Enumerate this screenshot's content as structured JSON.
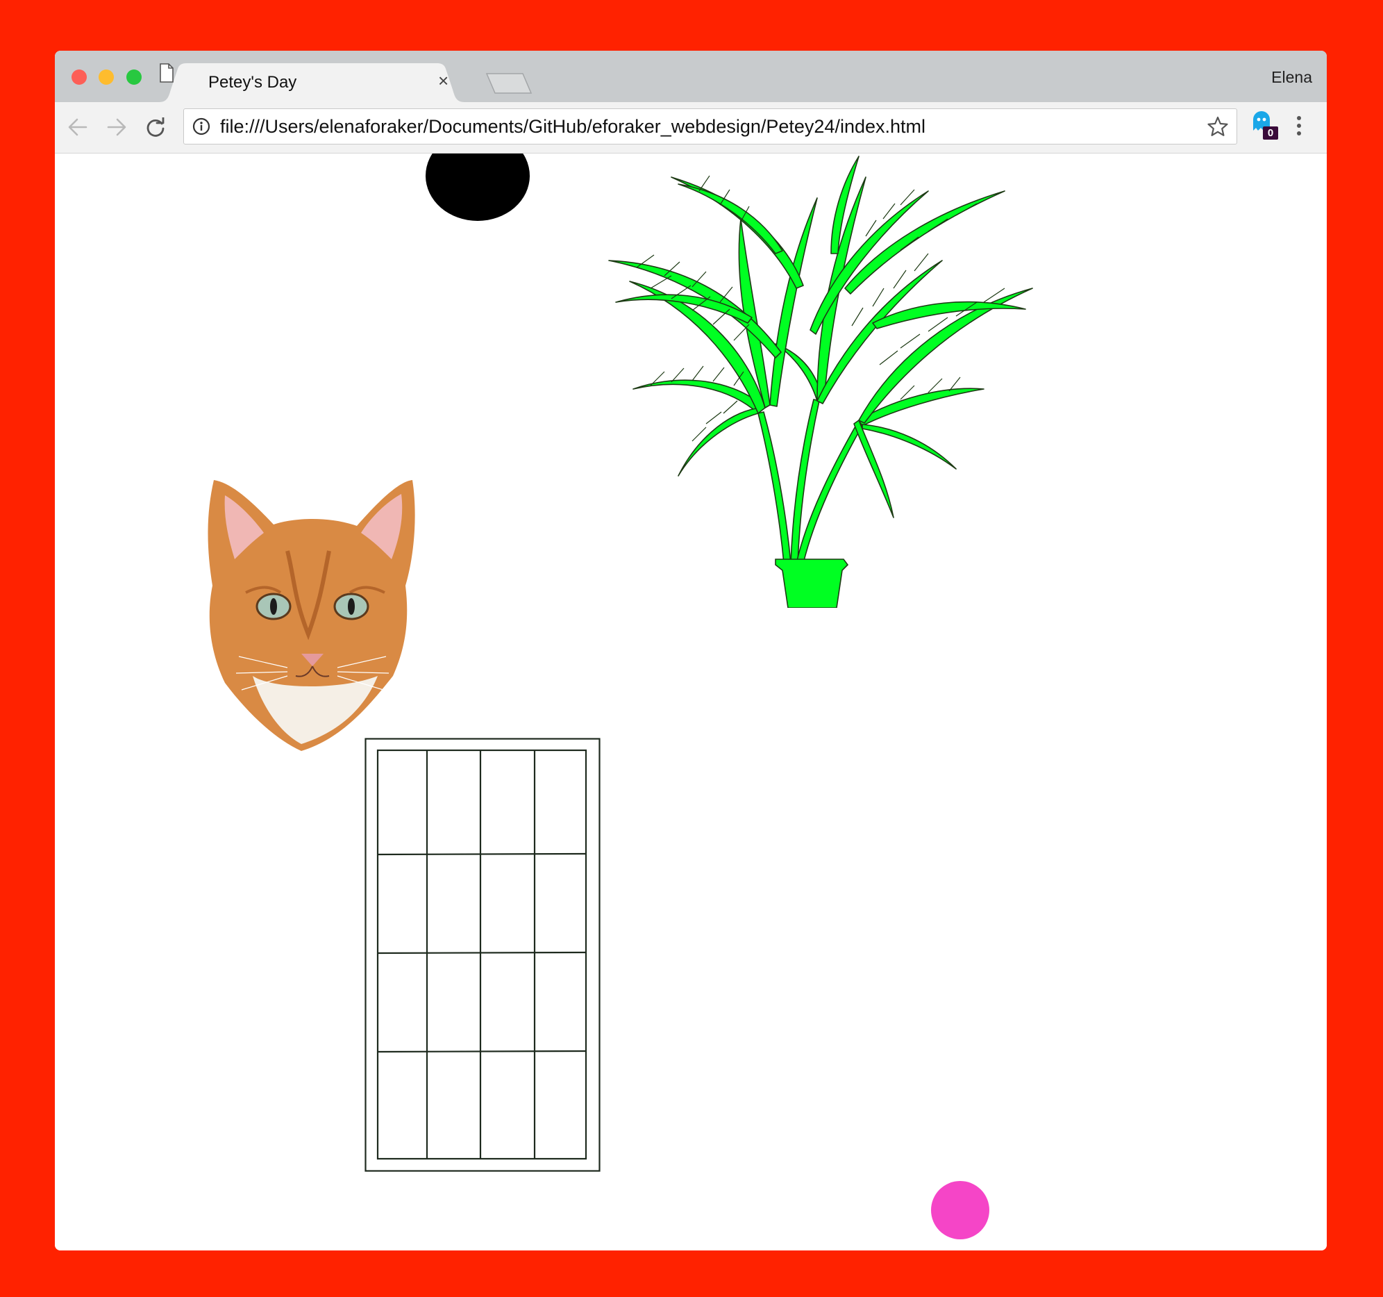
{
  "browser": {
    "tab_title": "Petey's Day",
    "tab_close_glyph": "×",
    "profile_name": "Elena",
    "url": "file:///Users/elenaforaker/Documents/GitHub/eforaker_webdesign/Petey24/index.html",
    "extension_badge": "0"
  },
  "icons": {
    "back": "back-arrow-icon",
    "forward": "forward-arrow-icon",
    "reload": "reload-icon",
    "info": "info-icon",
    "bookmark": "star-icon",
    "extension": "ghost-extension-icon",
    "menu": "kebab-menu-icon",
    "tab_page": "page-icon"
  },
  "colors": {
    "background": "#ff2200",
    "plant": "#00ff22",
    "ball_pink": "#f545c7",
    "ball_black": "#000000",
    "window_frame": "#1e2a1e",
    "close_light": "#fd5f57",
    "minimize_light": "#febc2e",
    "zoom_light": "#28c840"
  },
  "page": {
    "objects": [
      "black-ball",
      "palm-plant",
      "cat-head",
      "window-grid",
      "pink-ball"
    ]
  }
}
